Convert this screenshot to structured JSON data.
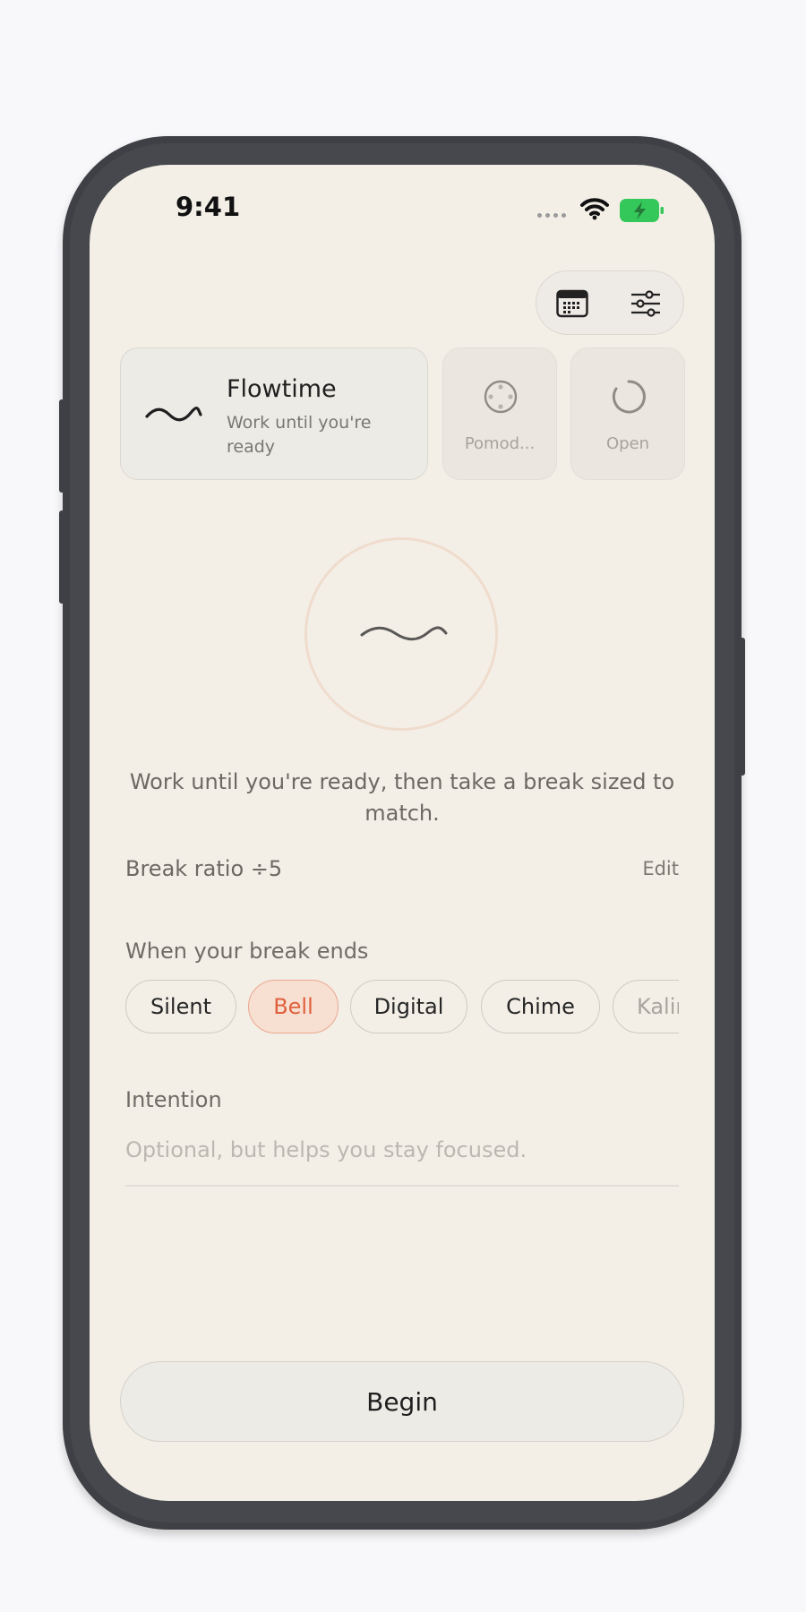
{
  "status_bar": {
    "time": "9:41"
  },
  "modes": {
    "flowtime": {
      "title": "Flowtime",
      "subtitle": "Work until you're ready"
    },
    "pomodoro": {
      "label": "Pomod..."
    },
    "open": {
      "label": "Open"
    }
  },
  "description": "Work until you're ready, then take a break sized to match.",
  "break_ratio": {
    "label": "Break ratio ÷5",
    "edit_label": "Edit"
  },
  "break_end": {
    "label": "When your break ends",
    "options": [
      "Silent",
      "Bell",
      "Digital",
      "Chime",
      "Kalimba"
    ],
    "selected": "Bell"
  },
  "intention": {
    "label": "Intention",
    "placeholder": "Optional, but helps you stay focused."
  },
  "begin_label": "Begin",
  "colors": {
    "background": "#f3efe7",
    "accent": "#e0603d",
    "accent_bg": "#f7dfd2",
    "battery": "#34c759"
  },
  "icons": {
    "calendar": "calendar-icon",
    "settings": "sliders-icon",
    "flow": "wave-icon",
    "pomodoro": "dial-icon",
    "open": "spinner-icon"
  }
}
